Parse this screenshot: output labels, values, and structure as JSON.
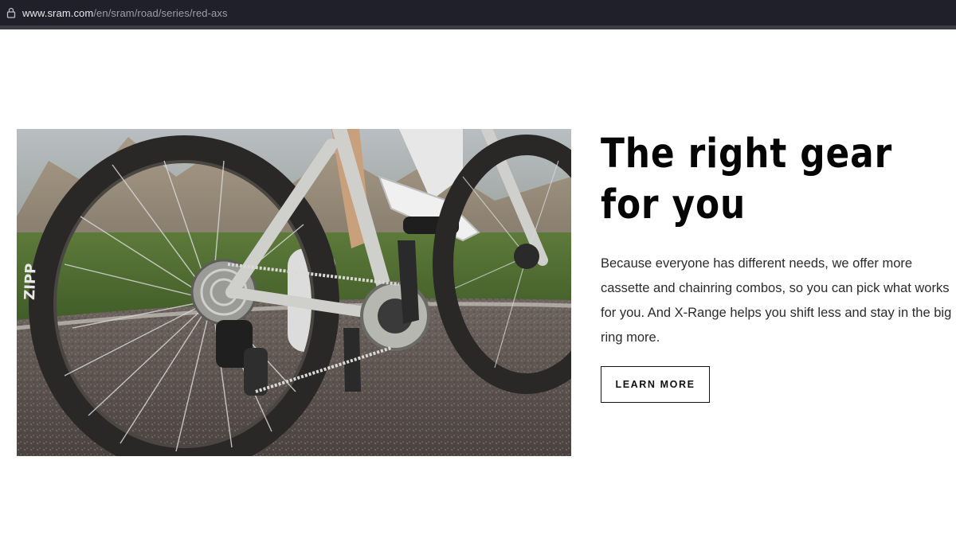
{
  "browser": {
    "url_host": "www.sram.com",
    "url_path": "/en/sram/road/series/red-axs",
    "lock_icon": "lock-icon"
  },
  "hero": {
    "image_alt": "Cyclist on a road bike with Zipp wheels and SRAM Red AXS drivetrain in front of mountains",
    "rim_brand": "ZIPP"
  },
  "content": {
    "title": "The right gear for you",
    "body": "Because everyone has different needs, we offer more cassette and chainring combos, so you can pick what works for you. And X-Range helps you shift less and stay in the big ring more.",
    "cta_label": "LEARN MORE"
  },
  "colors": {
    "addressbar_bg": "#1f2029",
    "title_color": "#050505",
    "button_border": "#111111"
  }
}
